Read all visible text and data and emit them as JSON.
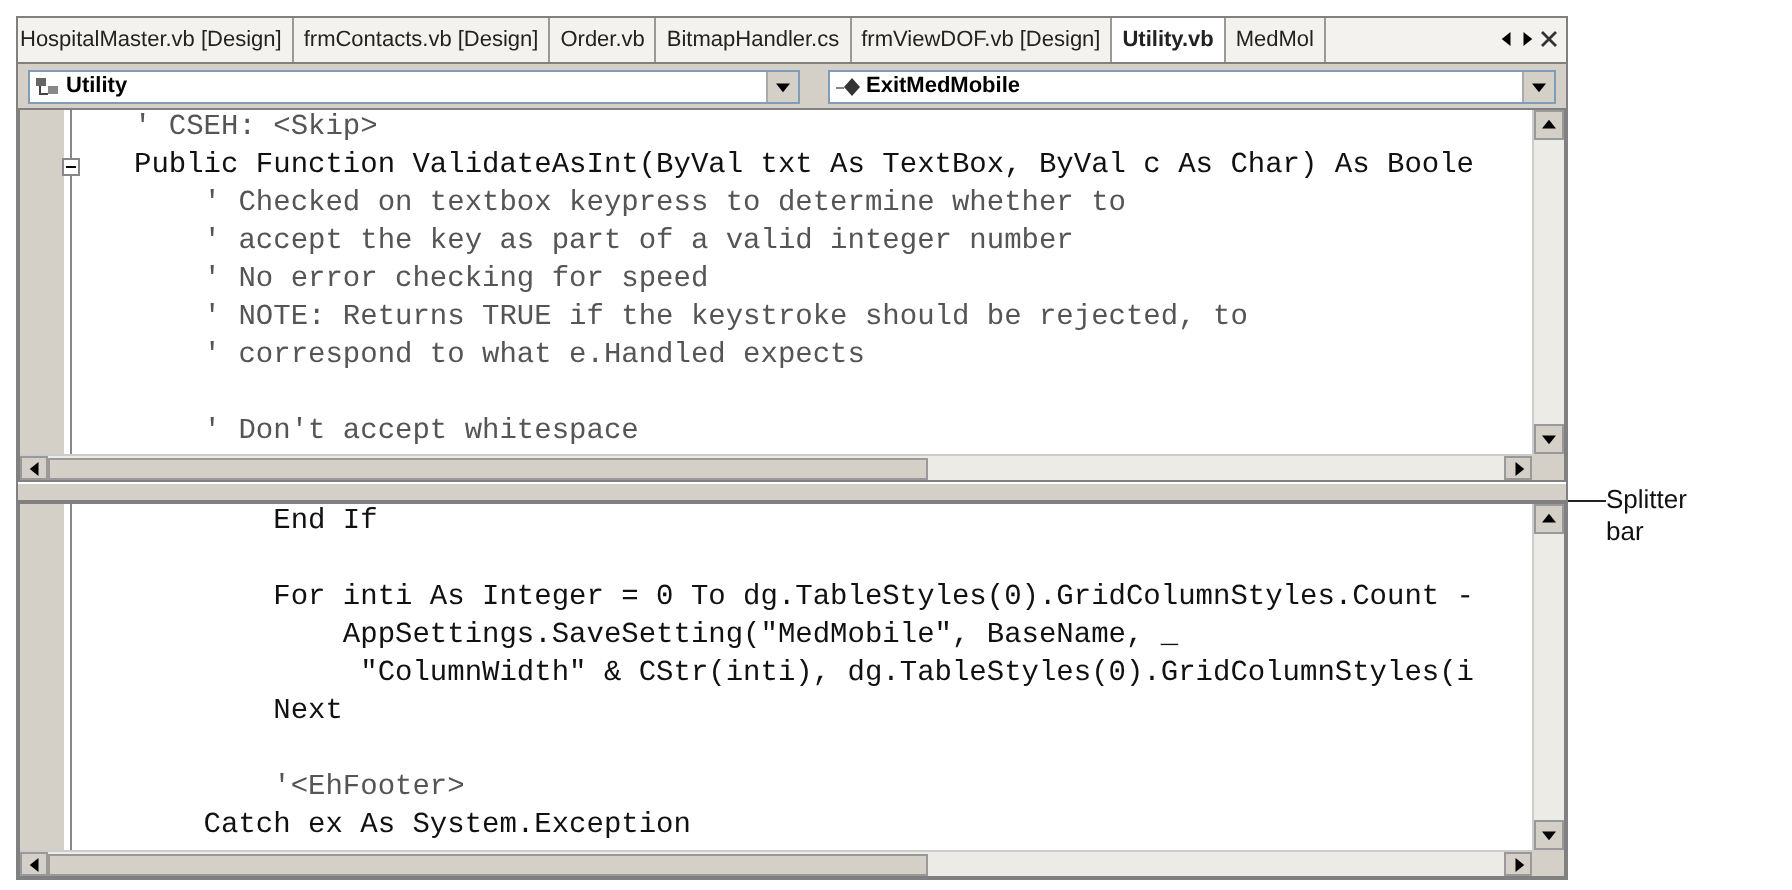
{
  "tabs": [
    {
      "label": "HospitalMaster.vb [Design]",
      "selected": false
    },
    {
      "label": "frmContacts.vb [Design]",
      "selected": false
    },
    {
      "label": "Order.vb",
      "selected": false
    },
    {
      "label": "BitmapHandler.cs",
      "selected": false
    },
    {
      "label": "frmViewDOF.vb [Design]",
      "selected": false
    },
    {
      "label": "Utility.vb",
      "selected": true
    },
    {
      "label": "MedMol",
      "selected": false
    }
  ],
  "class_dropdown": {
    "value": "Utility"
  },
  "method_dropdown": {
    "value": "ExitMedMobile"
  },
  "top_pane": {
    "lines": [
      {
        "text": "' CSEH: <Skip>",
        "kind": "comment"
      },
      {
        "text": "Public Function ValidateAsInt(ByVal txt As TextBox, ByVal c As Char) As Boole",
        "kind": "code",
        "fold": true
      },
      {
        "text": "    ' Checked on textbox keypress to determine whether to",
        "kind": "comment"
      },
      {
        "text": "    ' accept the key as part of a valid integer number",
        "kind": "comment"
      },
      {
        "text": "    ' No error checking for speed",
        "kind": "comment"
      },
      {
        "text": "    ' NOTE: Returns TRUE if the keystroke should be rejected, to",
        "kind": "comment"
      },
      {
        "text": "    ' correspond to what e.Handled expects",
        "kind": "comment"
      },
      {
        "kind": "blank"
      },
      {
        "text": "    ' Don't accept whitespace",
        "kind": "comment"
      }
    ]
  },
  "bottom_pane": {
    "lines": [
      {
        "text": "        End If",
        "kind": "code"
      },
      {
        "kind": "blank"
      },
      {
        "text": "        For inti As Integer = 0 To dg.TableStyles(0).GridColumnStyles.Count -",
        "kind": "code"
      },
      {
        "text": "            AppSettings.SaveSetting(\"MedMobile\", BaseName, _",
        "kind": "code"
      },
      {
        "text": "             \"ColumnWidth\" & CStr(inti), dg.TableStyles(0).GridColumnStyles(i",
        "kind": "code"
      },
      {
        "text": "        Next",
        "kind": "code"
      },
      {
        "kind": "blank"
      },
      {
        "text": "        '<EhFooter>",
        "kind": "comment"
      },
      {
        "text": "    Catch ex As System.Exception",
        "kind": "code"
      }
    ]
  },
  "callout": {
    "label": "Splitter bar"
  }
}
